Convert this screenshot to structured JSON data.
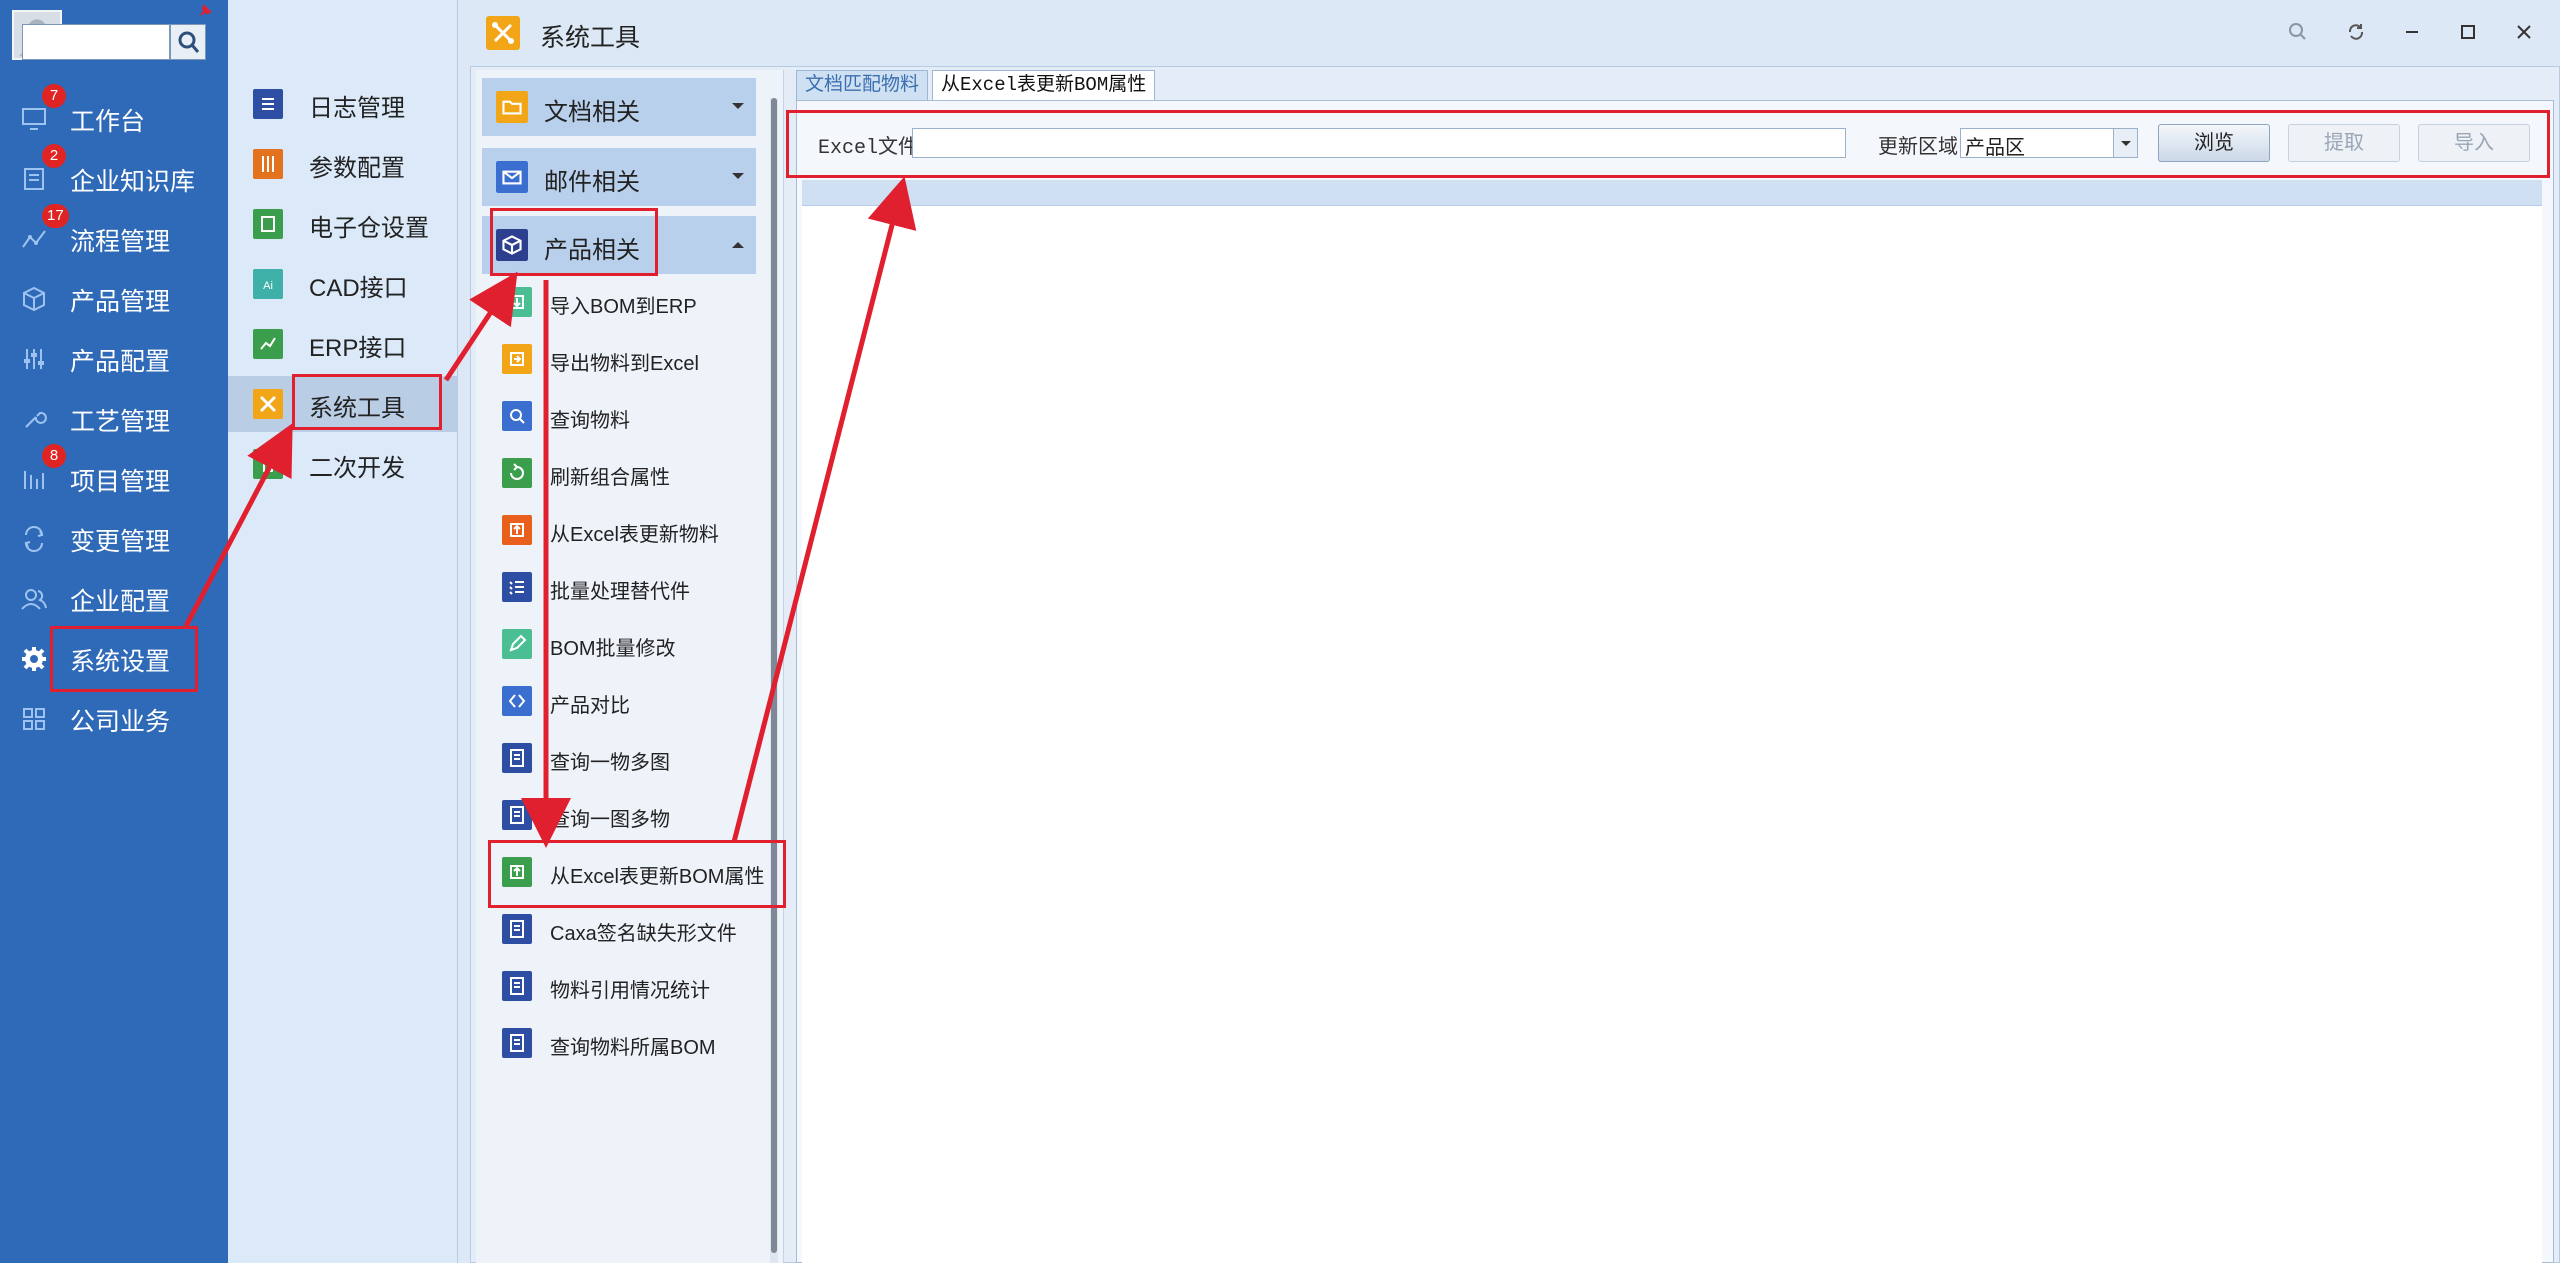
{
  "sidebar": {
    "items": [
      {
        "label": "工作台",
        "icon": "monitor-icon",
        "badge": "7"
      },
      {
        "label": "企业知识库",
        "icon": "book-icon",
        "badge": "2"
      },
      {
        "label": "流程管理",
        "icon": "flow-icon",
        "badge": "17"
      },
      {
        "label": "产品管理",
        "icon": "cube-icon",
        "badge": ""
      },
      {
        "label": "产品配置",
        "icon": "sliders-icon",
        "badge": ""
      },
      {
        "label": "工艺管理",
        "icon": "wrench-icon",
        "badge": ""
      },
      {
        "label": "项目管理",
        "icon": "project-icon",
        "badge": "8"
      },
      {
        "label": "变更管理",
        "icon": "change-icon",
        "badge": ""
      },
      {
        "label": "企业配置",
        "icon": "users-icon",
        "badge": ""
      },
      {
        "label": "系统设置",
        "icon": "gear-icon",
        "badge": ""
      },
      {
        "label": "公司业务",
        "icon": "grid-icon",
        "badge": ""
      }
    ]
  },
  "submenu": {
    "search_placeholder": "",
    "items": [
      {
        "label": "日志管理",
        "icon": "log-icon",
        "color": "#2d4ea3"
      },
      {
        "label": "参数配置",
        "icon": "params-icon",
        "color": "#e2721e"
      },
      {
        "label": "电子仓设置",
        "icon": "warehouse-icon",
        "color": "#3b9e4c"
      },
      {
        "label": "CAD接口",
        "icon": "cad-icon",
        "color": "#3fb0a8"
      },
      {
        "label": "ERP接口",
        "icon": "erp-icon",
        "color": "#3b9e4c"
      },
      {
        "label": "系统工具",
        "icon": "tools-icon",
        "color": "#f2a516"
      },
      {
        "label": "二次开发",
        "icon": "dev-icon",
        "color": "#3b9e4c"
      }
    ]
  },
  "header": {
    "title": "系统工具"
  },
  "categories": [
    {
      "label": "文档相关",
      "icon": "folder-icon",
      "color": "#f2a516",
      "expanded": false
    },
    {
      "label": "邮件相关",
      "icon": "mail-icon",
      "color": "#3a6fd0",
      "expanded": false
    },
    {
      "label": "产品相关",
      "icon": "product-icon",
      "color": "#2d3f8f",
      "expanded": true
    }
  ],
  "tools": [
    {
      "label": "导入BOM到ERP",
      "icon": "import-icon",
      "color": "#4bbf93"
    },
    {
      "label": "导出物料到Excel",
      "icon": "export-icon",
      "color": "#f2a516"
    },
    {
      "label": "查询物料",
      "icon": "search-icon",
      "color": "#3a6fd0"
    },
    {
      "label": "刷新组合属性",
      "icon": "refresh-icon",
      "color": "#3b9e4c"
    },
    {
      "label": "从Excel表更新物料",
      "icon": "upload-icon",
      "color": "#e8601c"
    },
    {
      "label": "批量处理替代件",
      "icon": "checklist-icon",
      "color": "#2d4ea3"
    },
    {
      "label": "BOM批量修改",
      "icon": "edit-icon",
      "color": "#4bbf93"
    },
    {
      "label": "产品对比",
      "icon": "compare-icon",
      "color": "#3a6fd0"
    },
    {
      "label": "查询一物多图",
      "icon": "doc-icon",
      "color": "#2d4ea3"
    },
    {
      "label": "查询一图多物",
      "icon": "doc-icon",
      "color": "#2d4ea3"
    },
    {
      "label": "从Excel表更新BOM属性",
      "icon": "upload-icon",
      "color": "#3b9e4c"
    },
    {
      "label": "Caxa签名缺失形文件",
      "icon": "doc-icon",
      "color": "#2d4ea3"
    },
    {
      "label": "物料引用情况统计",
      "icon": "doc-icon",
      "color": "#2d4ea3"
    },
    {
      "label": "查询物料所属BOM",
      "icon": "doc-icon",
      "color": "#2d4ea3"
    }
  ],
  "tabs": [
    {
      "label": "文档匹配物料",
      "active": false
    },
    {
      "label": "从Excel表更新BOM属性",
      "active": true
    }
  ],
  "form": {
    "file_label": "Excel文件",
    "file_value": "",
    "region_label": "更新区域",
    "region_value": "产品区",
    "browse_label": "浏览",
    "extract_label": "提取",
    "import_label": "导入"
  },
  "colors": {
    "sidebar_bg": "#2f6ab8",
    "highlight": "#e0202e",
    "badge": "#e02424"
  }
}
